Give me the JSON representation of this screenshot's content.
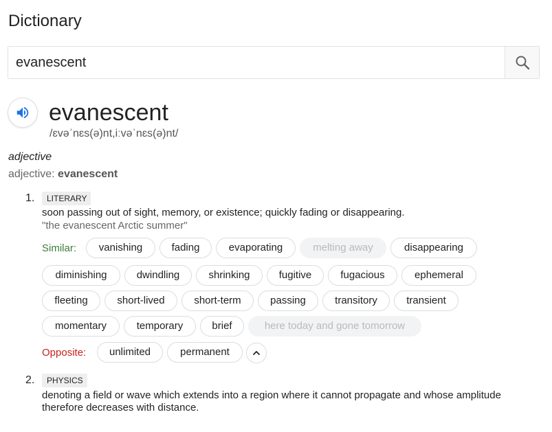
{
  "page": {
    "title": "Dictionary"
  },
  "search": {
    "value": "evanescent"
  },
  "entry": {
    "headword": "evanescent",
    "phonetic": "/ɛvəˈnɛs(ə)nt,iːvəˈnɛs(ə)nt/",
    "part_of_speech": "adjective",
    "pos_prefix": "adjective: ",
    "pos_word": "evanescent"
  },
  "senses": [
    {
      "number": "1.",
      "label": "LITERARY",
      "definition": "soon passing out of sight, memory, or existence; quickly fading or disappearing.",
      "example": "\"the evanescent Arctic summer\"",
      "similar_label": "Similar:",
      "similar": [
        "vanishing",
        "fading",
        "evaporating",
        "melting away",
        "disappearing",
        "diminishing",
        "dwindling",
        "shrinking",
        "fugitive",
        "fugacious",
        "ephemeral",
        "fleeting",
        "short-lived",
        "short-term",
        "passing",
        "transitory",
        "transient",
        "momentary",
        "temporary",
        "brief",
        "here today and gone tomorrow"
      ],
      "opposite_label": "Opposite:",
      "opposite": [
        "unlimited",
        "permanent"
      ]
    },
    {
      "number": "2.",
      "label": "PHYSICS",
      "definition_line1": "denoting a field or wave which extends into a region where it cannot propagate and whose amplitude",
      "definition_line2": "therefore decreases with distance."
    }
  ],
  "icons": {
    "search": "search-icon",
    "speaker": "speaker-icon",
    "collapse": "chevron-up-icon"
  },
  "colors": {
    "similar": "#3c7d3c",
    "opposite": "#c5221f",
    "speaker": "#1a73e8"
  }
}
